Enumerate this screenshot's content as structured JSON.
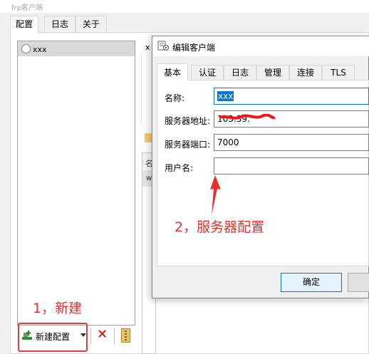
{
  "main_window": {
    "title": "frp客户端",
    "tabs": [
      {
        "label": "配置",
        "active": true
      },
      {
        "label": "日志",
        "active": false
      },
      {
        "label": "关于",
        "active": false
      }
    ],
    "config_list": [
      {
        "name": "xxx",
        "selected": true
      }
    ],
    "right_panel": {
      "status_prefix": "x",
      "table_header": "名",
      "table_row": "w"
    },
    "toolbar": {
      "new_label": "新建配置",
      "delete_icon": "delete-icon",
      "zip_icon": "archive-icon"
    }
  },
  "dialog": {
    "title": "编辑客户端",
    "tabs": [
      {
        "label": "基本",
        "active": true
      },
      {
        "label": "认证",
        "active": false
      },
      {
        "label": "日志",
        "active": false
      },
      {
        "label": "管理",
        "active": false
      },
      {
        "label": "连接",
        "active": false
      },
      {
        "label": "TLS",
        "active": false
      }
    ],
    "fields": {
      "name_label": "名称:",
      "name_value": "xxx",
      "server_addr_label": "服务器地址:",
      "server_addr_value": "103.39.",
      "server_port_label": "服务器端口:",
      "server_port_value": "7000",
      "username_label": "用户名:",
      "username_value": ""
    },
    "buttons": {
      "ok_label": "确定"
    }
  },
  "annotations": {
    "step1": "1，新建",
    "step2": "2，服务器配置",
    "color": "#e8302a"
  }
}
